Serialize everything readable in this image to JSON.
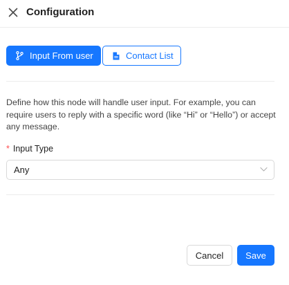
{
  "header": {
    "title": "Configuration",
    "close_icon": "close-icon"
  },
  "tabs": [
    {
      "label": "Input From user",
      "icon": "git-branch-icon",
      "active": true
    },
    {
      "label": "Contact List",
      "icon": "document-icon",
      "active": false
    }
  ],
  "description": "Define how this node will handle user input. For example, you can require users to reply with a specific word (like “Hi” or “Hello”) or accept any message.",
  "input_type": {
    "label": "Input Type",
    "required_marker": "*",
    "value": "Any"
  },
  "footer": {
    "cancel_label": "Cancel",
    "save_label": "Save"
  },
  "colors": {
    "primary": "#1677ff",
    "required": "#ff4d4f",
    "border": "#d9d9d9"
  }
}
